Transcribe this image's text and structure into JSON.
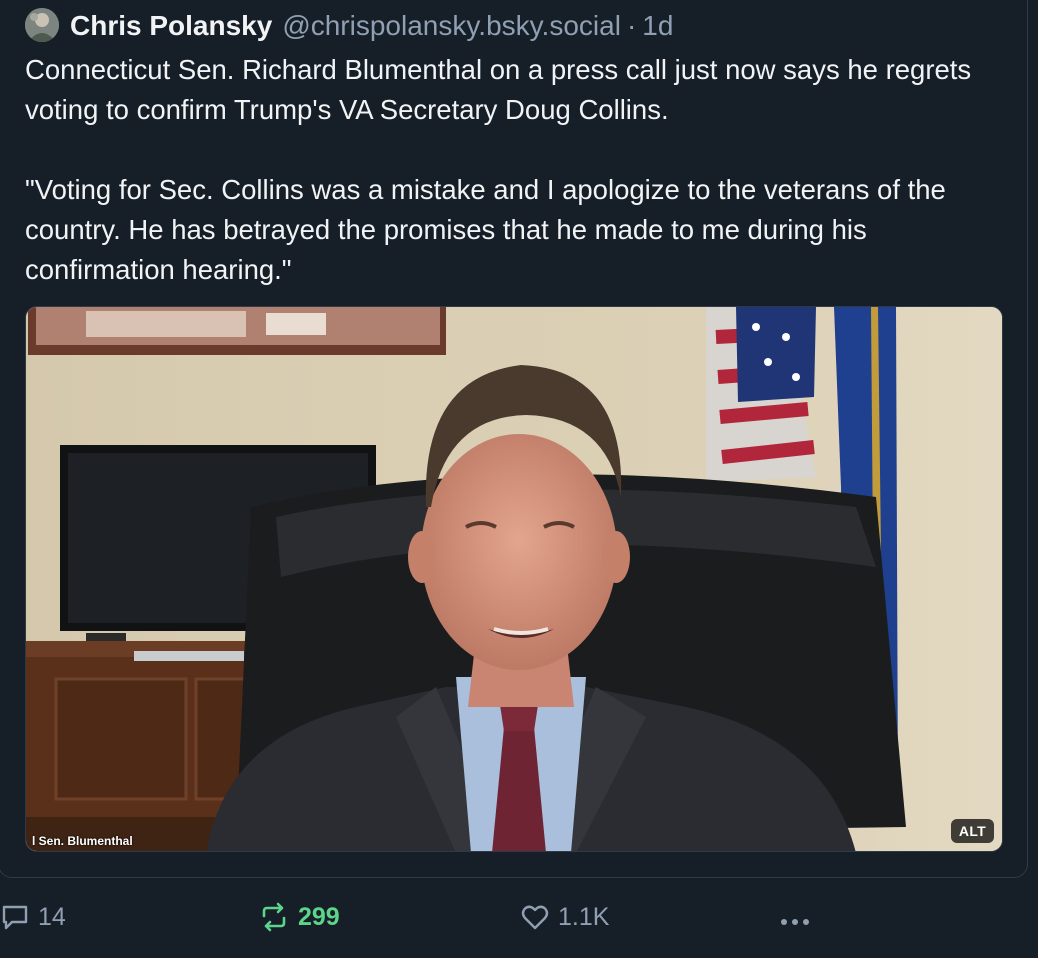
{
  "post": {
    "author": {
      "display_name": "Chris Polansky",
      "handle": "@chrispolansky.bsky.social",
      "separator": "·",
      "time": "1d",
      "avatar_icon": "avatar-photo"
    },
    "text": {
      "paragraph_1": "Connecticut Sen. Richard Blumenthal on a press call just now says he regrets voting to confirm Trump's VA Secretary Doug Collins.",
      "paragraph_2": "\"Voting for Sec. Collins was a mistake and I apologize to the veterans of the country. He has betrayed the promises that he made to me during his confirmation hearing.\""
    },
    "media": {
      "caption": "l Sen. Blumenthal",
      "alt_badge": "ALT"
    },
    "actions": {
      "reply_count": "14",
      "repost_count": "299",
      "like_count": "1.1K",
      "reply_icon": "comment-icon",
      "repost_icon": "repost-icon",
      "like_icon": "heart-icon",
      "more_icon": "more-icon"
    }
  },
  "colors": {
    "background": "#161e27",
    "text": "#f1f3f5",
    "muted": "#8fa0b3",
    "repost_active": "#5cd48a"
  }
}
